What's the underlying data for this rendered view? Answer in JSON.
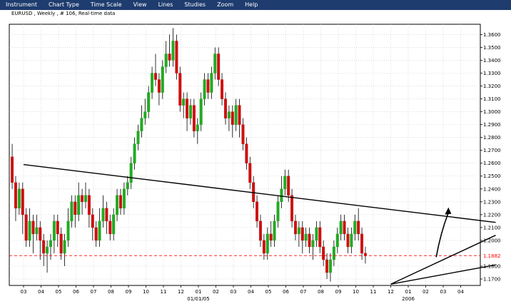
{
  "menu": {
    "items": [
      "Instrument",
      "Chart Type",
      "Time Scale",
      "View",
      "Lines",
      "Studies",
      "Zoom",
      "Help"
    ]
  },
  "chart_data": {
    "type": "candlestick",
    "title": "EURUSD , Weekly , # 106, Real-time data",
    "up_color": "#22aa22",
    "down_color": "#cc1111",
    "y_ticks": [
      "1.3600",
      "1.3500",
      "1.3400",
      "1.3300",
      "1.3200",
      "1.3100",
      "1.3000",
      "1.2900",
      "1.2800",
      "1.2700",
      "1.2600",
      "1.2500",
      "1.2400",
      "1.2300",
      "1.2200",
      "1.2100",
      "1.2000",
      "1.1800",
      "1.1700"
    ],
    "y_tick_values": [
      1.36,
      1.35,
      1.34,
      1.33,
      1.32,
      1.31,
      1.3,
      1.29,
      1.28,
      1.27,
      1.26,
      1.25,
      1.24,
      1.23,
      1.22,
      1.21,
      1.2,
      1.18,
      1.17
    ],
    "ylim": [
      1.165,
      1.368
    ],
    "x_ticks": [
      "03",
      "04",
      "05",
      "06",
      "07",
      "08",
      "09",
      "10",
      "11",
      "12",
      "01",
      "02",
      "03",
      "04",
      "05",
      "06",
      "07",
      "08",
      "09",
      "10",
      "11",
      "12",
      "01",
      "02",
      "03",
      "04"
    ],
    "x_year_labels": [
      {
        "label": "01/01/05",
        "under_tick": 10
      },
      {
        "label": "2006",
        "under_tick": 22
      }
    ],
    "current_price": {
      "value": 1.1882,
      "label": "1.1882",
      "color": "#ff0000"
    },
    "trendlines": [
      {
        "points": [
          [
            0.0,
            1.259
          ],
          [
            27.0,
            1.214
          ]
        ],
        "color": "#000000"
      },
      {
        "points": [
          [
            21.0,
            1.166
          ],
          [
            27.0,
            1.204
          ]
        ],
        "color": "#000000"
      },
      {
        "points": [
          [
            21.0,
            1.166
          ],
          [
            27.0,
            1.181
          ]
        ],
        "color": "#000000"
      }
    ],
    "arrow": {
      "from": [
        23.6,
        1.187
      ],
      "to": [
        24.3,
        1.224
      ],
      "color": "#000000"
    },
    "candles": [
      [
        -0.85,
        1.28,
        1.265,
        1.29,
        1.245
      ],
      [
        -0.65,
        1.265,
        1.245,
        1.275,
        1.24
      ],
      [
        -0.45,
        1.245,
        1.225,
        1.25,
        1.215
      ],
      [
        -0.25,
        1.225,
        1.24,
        1.245,
        1.22
      ],
      [
        -0.05,
        1.24,
        1.22,
        1.245,
        1.205
      ],
      [
        0.15,
        1.22,
        1.2,
        1.225,
        1.195
      ],
      [
        0.35,
        1.2,
        1.215,
        1.225,
        1.195
      ],
      [
        0.55,
        1.215,
        1.205,
        1.22,
        1.19
      ],
      [
        0.75,
        1.205,
        1.21,
        1.22,
        1.2
      ],
      [
        0.95,
        1.21,
        1.2,
        1.215,
        1.185
      ],
      [
        1.15,
        1.2,
        1.19,
        1.205,
        1.18
      ],
      [
        1.35,
        1.19,
        1.195,
        1.2,
        1.175
      ],
      [
        1.55,
        1.195,
        1.2,
        1.205,
        1.185
      ],
      [
        1.75,
        1.2,
        1.215,
        1.22,
        1.19
      ],
      [
        1.95,
        1.215,
        1.205,
        1.22,
        1.195
      ],
      [
        2.15,
        1.205,
        1.19,
        1.21,
        1.185
      ],
      [
        2.35,
        1.19,
        1.2,
        1.205,
        1.18
      ],
      [
        2.55,
        1.2,
        1.215,
        1.225,
        1.195
      ],
      [
        2.75,
        1.215,
        1.23,
        1.235,
        1.21
      ],
      [
        2.95,
        1.23,
        1.22,
        1.235,
        1.21
      ],
      [
        3.15,
        1.22,
        1.235,
        1.245,
        1.215
      ],
      [
        3.35,
        1.235,
        1.23,
        1.24,
        1.22
      ],
      [
        3.55,
        1.23,
        1.235,
        1.245,
        1.225
      ],
      [
        3.75,
        1.235,
        1.22,
        1.24,
        1.21
      ],
      [
        3.95,
        1.22,
        1.21,
        1.225,
        1.2
      ],
      [
        4.15,
        1.21,
        1.2,
        1.215,
        1.195
      ],
      [
        4.35,
        1.2,
        1.215,
        1.225,
        1.195
      ],
      [
        4.55,
        1.215,
        1.225,
        1.235,
        1.21
      ],
      [
        4.75,
        1.225,
        1.215,
        1.23,
        1.205
      ],
      [
        4.95,
        1.215,
        1.205,
        1.22,
        1.2
      ],
      [
        5.15,
        1.205,
        1.22,
        1.225,
        1.2
      ],
      [
        5.35,
        1.22,
        1.235,
        1.24,
        1.215
      ],
      [
        5.55,
        1.235,
        1.225,
        1.24,
        1.22
      ],
      [
        5.75,
        1.225,
        1.24,
        1.245,
        1.22
      ],
      [
        5.95,
        1.24,
        1.245,
        1.25,
        1.235
      ],
      [
        6.15,
        1.245,
        1.26,
        1.265,
        1.24
      ],
      [
        6.35,
        1.26,
        1.275,
        1.28,
        1.255
      ],
      [
        6.55,
        1.275,
        1.285,
        1.29,
        1.27
      ],
      [
        6.75,
        1.285,
        1.295,
        1.305,
        1.28
      ],
      [
        6.95,
        1.295,
        1.3,
        1.31,
        1.29
      ],
      [
        7.15,
        1.3,
        1.315,
        1.32,
        1.295
      ],
      [
        7.35,
        1.315,
        1.33,
        1.335,
        1.31
      ],
      [
        7.55,
        1.33,
        1.325,
        1.345,
        1.32
      ],
      [
        7.75,
        1.325,
        1.315,
        1.33,
        1.305
      ],
      [
        7.95,
        1.315,
        1.335,
        1.34,
        1.31
      ],
      [
        8.15,
        1.335,
        1.345,
        1.355,
        1.33
      ],
      [
        8.35,
        1.345,
        1.34,
        1.36,
        1.335
      ],
      [
        8.55,
        1.34,
        1.355,
        1.365,
        1.335
      ],
      [
        8.75,
        1.355,
        1.33,
        1.36,
        1.325
      ],
      [
        8.95,
        1.33,
        1.305,
        1.335,
        1.3
      ],
      [
        9.15,
        1.305,
        1.31,
        1.315,
        1.295
      ],
      [
        9.35,
        1.31,
        1.295,
        1.315,
        1.285
      ],
      [
        9.55,
        1.295,
        1.305,
        1.31,
        1.29
      ],
      [
        9.75,
        1.305,
        1.285,
        1.31,
        1.28
      ],
      [
        9.95,
        1.285,
        1.29,
        1.295,
        1.275
      ],
      [
        10.15,
        1.29,
        1.31,
        1.315,
        1.285
      ],
      [
        10.35,
        1.31,
        1.325,
        1.33,
        1.305
      ],
      [
        10.55,
        1.325,
        1.315,
        1.33,
        1.31
      ],
      [
        10.75,
        1.315,
        1.33,
        1.335,
        1.31
      ],
      [
        10.95,
        1.33,
        1.345,
        1.35,
        1.325
      ],
      [
        11.15,
        1.345,
        1.325,
        1.35,
        1.32
      ],
      [
        11.35,
        1.325,
        1.31,
        1.33,
        1.305
      ],
      [
        11.55,
        1.31,
        1.295,
        1.315,
        1.29
      ],
      [
        11.75,
        1.295,
        1.3,
        1.305,
        1.285
      ],
      [
        11.95,
        1.3,
        1.29,
        1.305,
        1.28
      ],
      [
        12.15,
        1.29,
        1.305,
        1.31,
        1.285
      ],
      [
        12.35,
        1.305,
        1.29,
        1.31,
        1.28
      ],
      [
        12.55,
        1.29,
        1.275,
        1.295,
        1.27
      ],
      [
        12.75,
        1.275,
        1.26,
        1.28,
        1.255
      ],
      [
        12.95,
        1.26,
        1.245,
        1.265,
        1.24
      ],
      [
        13.15,
        1.245,
        1.23,
        1.25,
        1.225
      ],
      [
        13.35,
        1.23,
        1.215,
        1.235,
        1.21
      ],
      [
        13.55,
        1.215,
        1.2,
        1.22,
        1.195
      ],
      [
        13.75,
        1.2,
        1.19,
        1.205,
        1.185
      ],
      [
        13.95,
        1.19,
        1.205,
        1.21,
        1.185
      ],
      [
        14.15,
        1.205,
        1.2,
        1.215,
        1.195
      ],
      [
        14.35,
        1.2,
        1.215,
        1.22,
        1.195
      ],
      [
        14.55,
        1.215,
        1.23,
        1.235,
        1.21
      ],
      [
        14.75,
        1.23,
        1.24,
        1.25,
        1.225
      ],
      [
        14.95,
        1.24,
        1.25,
        1.255,
        1.235
      ],
      [
        15.15,
        1.25,
        1.235,
        1.255,
        1.23
      ],
      [
        15.35,
        1.235,
        1.215,
        1.24,
        1.21
      ],
      [
        15.55,
        1.215,
        1.205,
        1.22,
        1.2
      ],
      [
        15.75,
        1.205,
        1.21,
        1.215,
        1.195
      ],
      [
        15.95,
        1.21,
        1.2,
        1.215,
        1.19
      ],
      [
        16.15,
        1.2,
        1.205,
        1.21,
        1.195
      ],
      [
        16.35,
        1.205,
        1.195,
        1.21,
        1.19
      ],
      [
        16.55,
        1.195,
        1.2,
        1.205,
        1.185
      ],
      [
        16.75,
        1.2,
        1.21,
        1.215,
        1.195
      ],
      [
        16.95,
        1.21,
        1.195,
        1.215,
        1.19
      ],
      [
        17.15,
        1.195,
        1.185,
        1.2,
        1.18
      ],
      [
        17.35,
        1.185,
        1.175,
        1.19,
        1.17
      ],
      [
        17.55,
        1.175,
        1.185,
        1.19,
        1.168
      ],
      [
        17.75,
        1.185,
        1.195,
        1.2,
        1.18
      ],
      [
        17.95,
        1.195,
        1.205,
        1.21,
        1.19
      ],
      [
        18.15,
        1.205,
        1.215,
        1.22,
        1.2
      ],
      [
        18.35,
        1.215,
        1.205,
        1.22,
        1.2
      ],
      [
        18.55,
        1.205,
        1.195,
        1.21,
        1.19
      ],
      [
        18.75,
        1.195,
        1.205,
        1.21,
        1.19
      ],
      [
        18.95,
        1.205,
        1.215,
        1.22,
        1.2
      ],
      [
        19.15,
        1.215,
        1.205,
        1.225,
        1.2
      ],
      [
        19.35,
        1.205,
        1.19,
        1.21,
        1.185
      ],
      [
        19.55,
        1.19,
        1.188,
        1.195,
        1.182
      ]
    ]
  }
}
